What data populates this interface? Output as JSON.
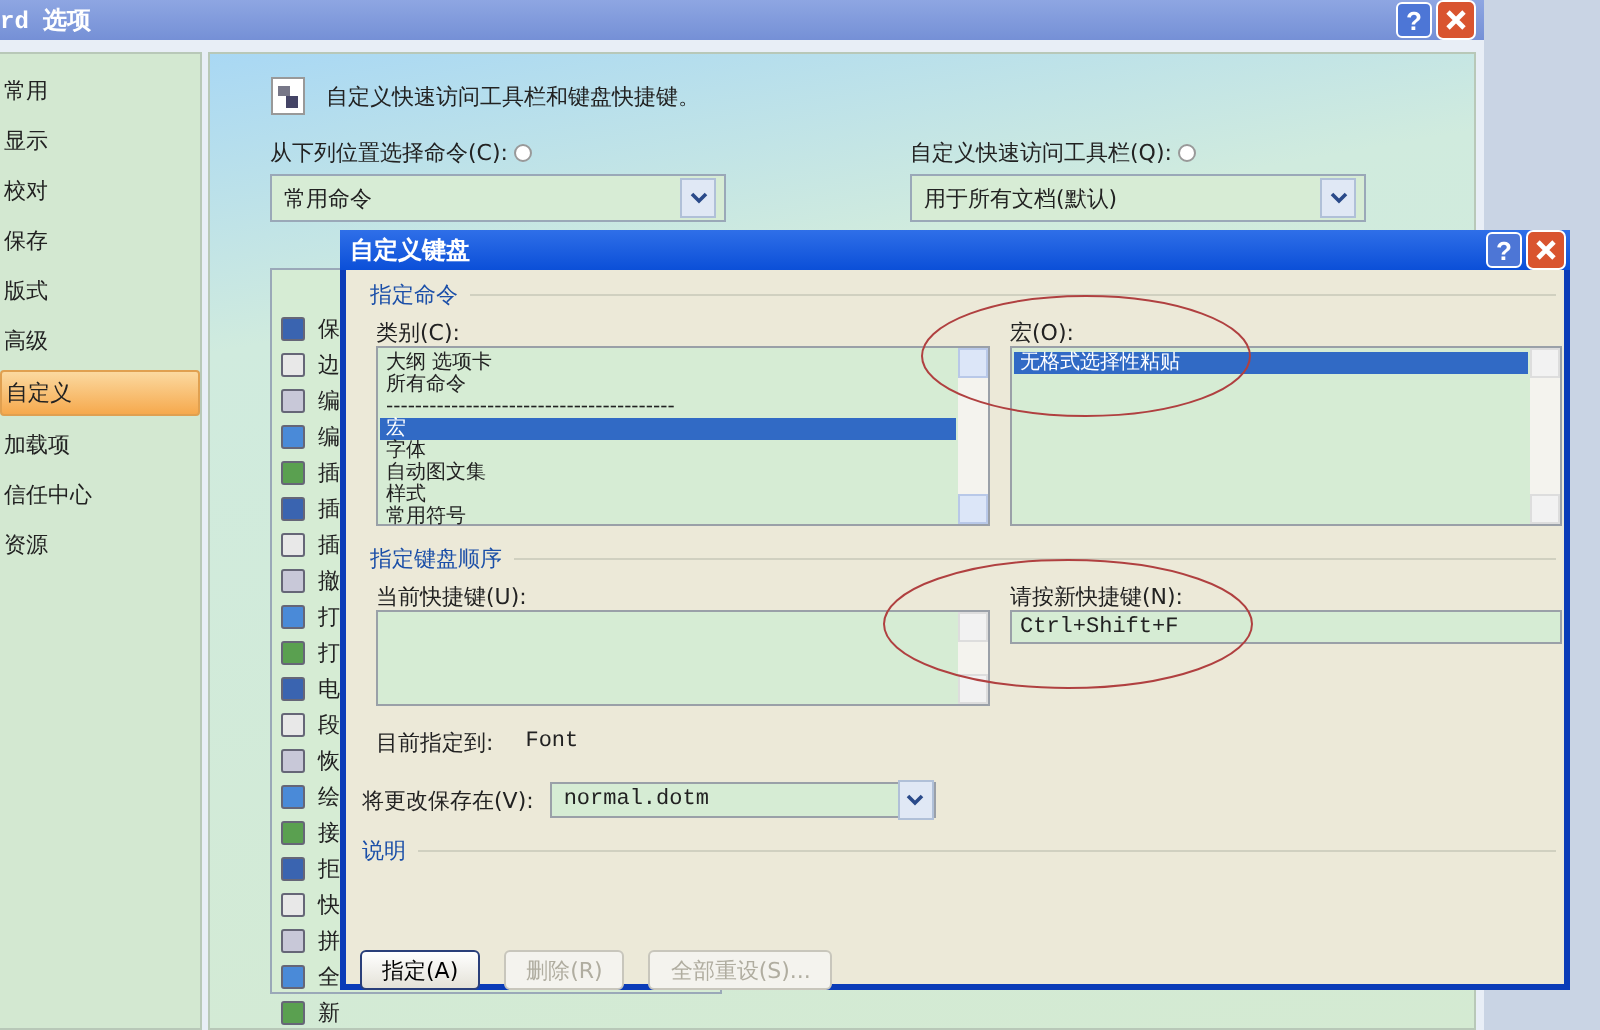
{
  "window": {
    "title": "rd 选项",
    "help_button": "?"
  },
  "sidebar": {
    "items": [
      {
        "label": "常用",
        "selected": false
      },
      {
        "label": "显示",
        "selected": false
      },
      {
        "label": "校对",
        "selected": false
      },
      {
        "label": "保存",
        "selected": false
      },
      {
        "label": "版式",
        "selected": false
      },
      {
        "label": "高级",
        "selected": false
      },
      {
        "label": "自定义",
        "selected": true
      },
      {
        "label": "加载项",
        "selected": false
      },
      {
        "label": "信任中心",
        "selected": false
      },
      {
        "label": "资源",
        "selected": false
      }
    ]
  },
  "main": {
    "heading": "自定义快速访问工具栏和键盘快捷键。",
    "choose_label": "从下列位置选择命令(C):",
    "choose_value": "常用命令",
    "toolbar_label": "自定义快速访问工具栏(Q):",
    "toolbar_value": "用于所有文档(默认)",
    "commands": [
      "保",
      "边",
      "编",
      "编",
      "插",
      "插",
      "插",
      "撤",
      "打",
      "打",
      "电",
      "段",
      "恢",
      "绘",
      "接",
      "拒",
      "快",
      "拼",
      "全",
      "新"
    ]
  },
  "dialog": {
    "title": "自定义键盘",
    "help_button": "?",
    "command_group": "指定命令",
    "categories_label": "类别(C):",
    "categories": [
      {
        "label": "大纲 选项卡",
        "selected": false
      },
      {
        "label": "所有命令",
        "selected": false
      },
      {
        "label": "----------------------------------------",
        "selected": false
      },
      {
        "label": "宏",
        "selected": true
      },
      {
        "label": "字体",
        "selected": false
      },
      {
        "label": "自动图文集",
        "selected": false
      },
      {
        "label": "样式",
        "selected": false
      },
      {
        "label": "常用符号",
        "selected": false
      }
    ],
    "macros_label": "宏(O):",
    "macros": [
      {
        "label": "无格式选择性粘贴",
        "selected": true
      }
    ],
    "keys_group": "指定键盘顺序",
    "current_keys_label": "当前快捷键(U):",
    "new_key_label": "请按新快捷键(N):",
    "new_key_value": "Ctrl+Shift+F",
    "assigned_label": "目前指定到:",
    "assigned_value": "Font",
    "save_in_label": "将更改保存在(V):",
    "save_in_value": "normal.dotm",
    "description_group": "说明",
    "buttons": [
      {
        "label": "指定(A)",
        "disabled": false
      },
      {
        "label": "删除(R)",
        "disabled": true
      },
      {
        "label": "全部重设(S)...",
        "disabled": true
      }
    ]
  }
}
